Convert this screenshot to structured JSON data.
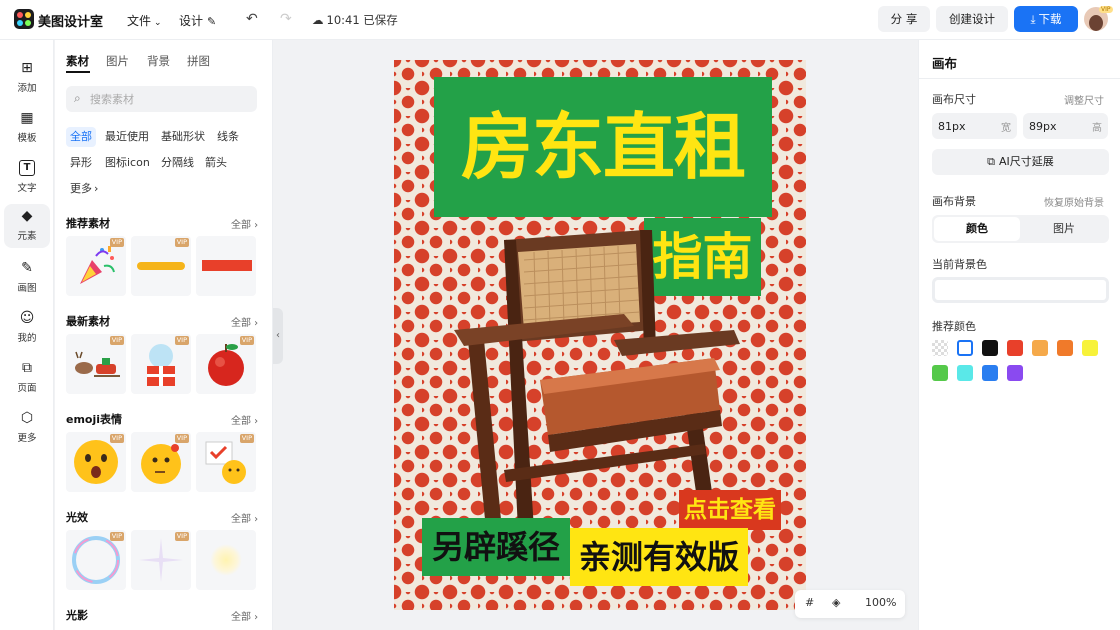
{
  "app": {
    "title": "美图设计室"
  },
  "topbar": {
    "menu_file": "文件",
    "menu_design": "设计",
    "saved_status": "10:41 已保存",
    "share_label": "分 享",
    "create_label": "创建设计",
    "download_label": "下载",
    "vip_label": "VIP"
  },
  "rail": {
    "items": [
      {
        "label": "添加",
        "icon": "plus-square-icon"
      },
      {
        "label": "模板",
        "icon": "template-icon"
      },
      {
        "label": "文字",
        "icon": "text-icon"
      },
      {
        "label": "元素",
        "icon": "shapes-icon"
      },
      {
        "label": "画图",
        "icon": "pen-icon"
      },
      {
        "label": "我的",
        "icon": "user-icon"
      },
      {
        "label": "页面",
        "icon": "page-add-icon"
      },
      {
        "label": "更多",
        "icon": "cube-icon"
      }
    ]
  },
  "panel": {
    "tabs": [
      "素材",
      "图片",
      "背景",
      "拼图"
    ],
    "search_placeholder": "搜索素材",
    "chips": [
      "全部",
      "最近使用",
      "基础形状",
      "线条",
      "异形",
      "图标icon",
      "分隔线",
      "箭头",
      "更多"
    ],
    "all_label": "全部",
    "vip_label": "VIP",
    "sections": [
      "推荐素材",
      "最新素材",
      "emoji表情",
      "光效",
      "光影"
    ]
  },
  "poster": {
    "title": "房东直租",
    "subtitle": "指南",
    "click_tag": "点击查看",
    "tag_green": "另辟蹊径",
    "tag_yellow": "亲测有效版",
    "colors": {
      "green": "#23a148",
      "yellow": "#ffe512",
      "red": "#d6412a",
      "cream": "#f1e9dd"
    }
  },
  "canvas_tools": {
    "zoom": "100%"
  },
  "right": {
    "title": "画布",
    "size_label": "画布尺寸",
    "size_link": "调整尺寸",
    "width_value": "81px",
    "width_unit": "宽",
    "height_value": "89px",
    "height_unit": "高",
    "ai_extend": "AI尺寸延展",
    "bg_label": "画布背景",
    "bg_reset": "恢复原始背景",
    "seg_color": "颜色",
    "seg_image": "图片",
    "current_bg_label": "当前背景色",
    "recommend_label": "推荐颜色",
    "swatches": [
      "transparent",
      "#ffffff",
      "#111111",
      "#e8402a",
      "#f5a94a",
      "#f07a2a",
      "#f7f23a",
      "#55c94a",
      "#5ae8e8",
      "#2a7ef0",
      "#8a4af0"
    ]
  }
}
